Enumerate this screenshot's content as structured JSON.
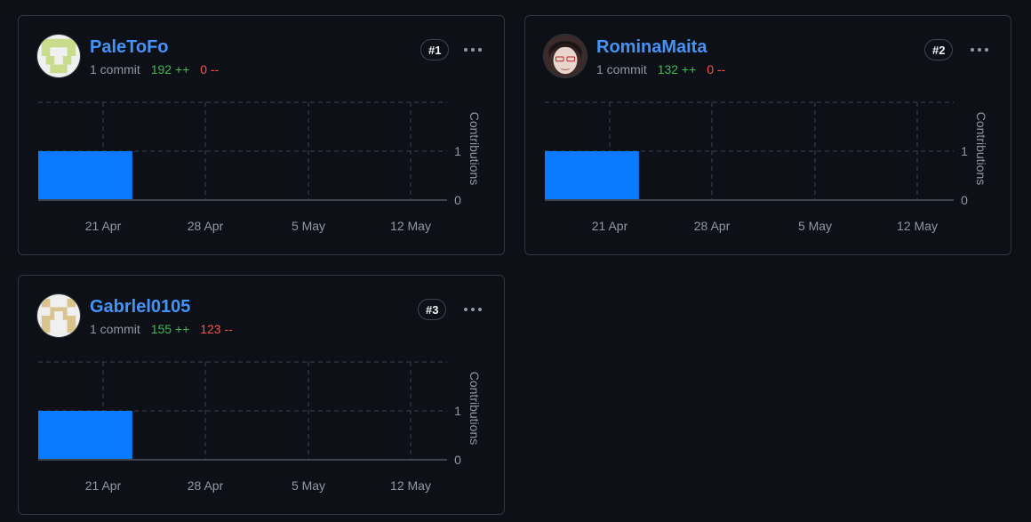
{
  "colors": {
    "background": "#0d1117",
    "border": "#30363d",
    "username": "#4493f8",
    "additions": "#3fb950",
    "deletions": "#f85149",
    "bar": "#0a7bff",
    "muted": "#9198a1"
  },
  "cards": [
    {
      "username": "PaleToFo",
      "avatar": "identicon-avatar-green",
      "commits": "1 commit",
      "additions": "192 ++",
      "deletions": "0 --",
      "rank": "#1",
      "menu_icon": "kebab-horizontal-icon"
    },
    {
      "username": "RominaMaita",
      "avatar": "photo-avatar",
      "commits": "1 commit",
      "additions": "132 ++",
      "deletions": "0 --",
      "rank": "#2",
      "menu_icon": "kebab-horizontal-icon"
    },
    {
      "username": "Gabrlel0105",
      "avatar": "identicon-avatar-tan",
      "commits": "1 commit",
      "additions": "155 ++",
      "deletions": "123 --",
      "rank": "#3",
      "menu_icon": "kebab-horizontal-icon"
    }
  ],
  "chart_data": [
    {
      "type": "bar",
      "ylabel": "Contributions",
      "x_ticks": [
        "21 Apr",
        "28 Apr",
        "5 May",
        "12 May"
      ],
      "y_ticks": [
        "0",
        "1"
      ],
      "ylim": [
        0,
        2
      ],
      "grid": true,
      "bars": [
        {
          "start": "2025-04-16",
          "end": "2025-04-23",
          "value": 1
        }
      ]
    },
    {
      "type": "bar",
      "ylabel": "Contributions",
      "x_ticks": [
        "21 Apr",
        "28 Apr",
        "5 May",
        "12 May"
      ],
      "y_ticks": [
        "0",
        "1"
      ],
      "ylim": [
        0,
        2
      ],
      "grid": true,
      "bars": [
        {
          "start": "2025-04-16",
          "end": "2025-04-23",
          "value": 1
        }
      ]
    },
    {
      "type": "bar",
      "ylabel": "Contributions",
      "x_ticks": [
        "21 Apr",
        "28 Apr",
        "5 May",
        "12 May"
      ],
      "y_ticks": [
        "0",
        "1"
      ],
      "ylim": [
        0,
        2
      ],
      "grid": true,
      "bars": [
        {
          "start": "2025-04-16",
          "end": "2025-04-23",
          "value": 1
        }
      ]
    }
  ]
}
